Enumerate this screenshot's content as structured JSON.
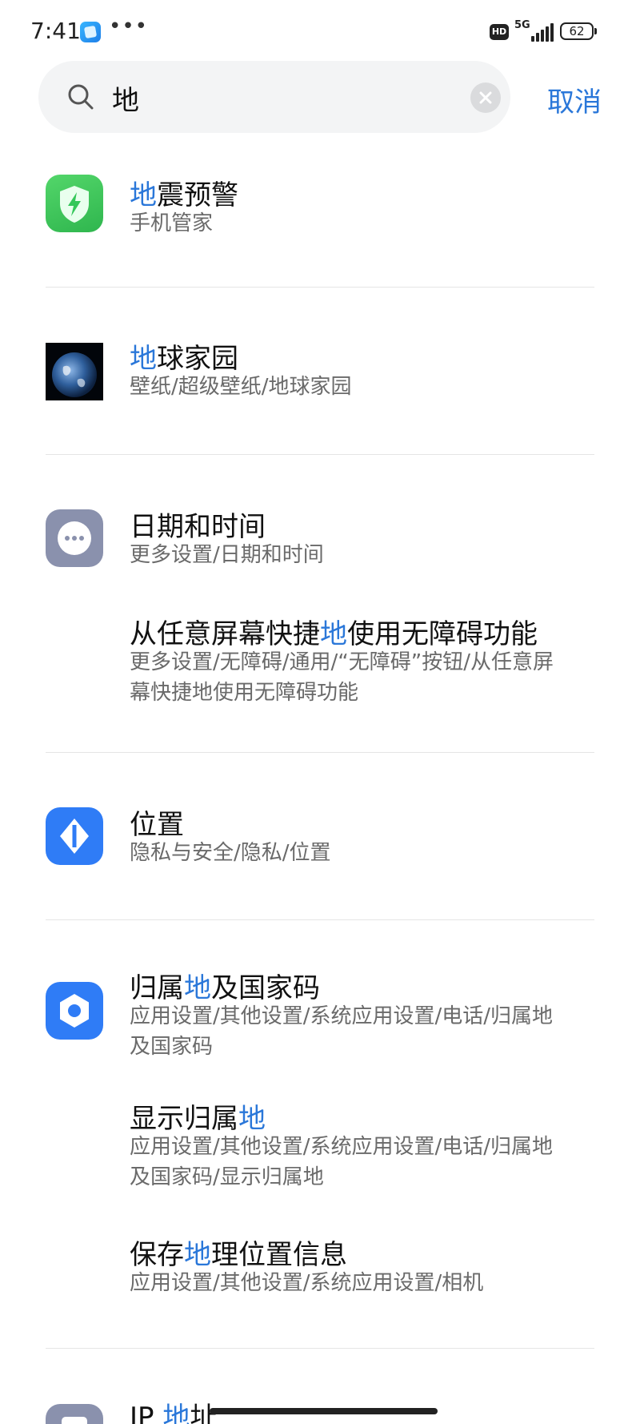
{
  "status_bar": {
    "time": "7:41",
    "dots": "•••",
    "hd_label": "HD",
    "network": "5G",
    "battery_level": "62",
    "icons": [
      "app-icon",
      "hd-icon",
      "signal-icon",
      "battery-icon"
    ]
  },
  "search": {
    "query": "地",
    "cancel_label": "取消",
    "icons": [
      "search-icon",
      "clear-icon"
    ]
  },
  "results": [
    {
      "icon": "shield-bolt-icon",
      "icon_color": "#34c759",
      "title_parts": [
        "地",
        "震预警"
      ],
      "subtitle": "手机管家"
    },
    {
      "icon": "earth-image-icon",
      "title_parts": [
        "地",
        "球家园"
      ],
      "subtitle": "壁纸/超级壁纸/地球家园"
    },
    {
      "icon": "more-settings-icon",
      "icon_color": "#8a91ad",
      "title_parts": [
        "日期和时间"
      ],
      "subtitle": "更多设置/日期和时间"
    },
    {
      "title_parts": [
        "从任意屏幕快捷",
        "地",
        "使用无障碍功能"
      ],
      "subtitle_lines": [
        "更多设置/无障碍/通用/“无障碍”按钮/从任意屏",
        "幕快捷地使用无障碍功能"
      ]
    },
    {
      "icon": "location-icon",
      "icon_color": "#2f7cf6",
      "title_parts": [
        "位置"
      ],
      "subtitle": "隐私与安全/隐私/位置"
    },
    {
      "icon": "app-settings-icon",
      "icon_color": "#2f7cf6",
      "title_parts": [
        "归属",
        "地",
        "及国家码"
      ],
      "subtitle_lines": [
        "应用设置/其他设置/系统应用设置/电话/归属地",
        "及国家码"
      ]
    },
    {
      "title_parts": [
        "显示归属",
        "地"
      ],
      "subtitle_lines": [
        "应用设置/其他设置/系统应用设置/电话/归属地",
        "及国家码/显示归属地"
      ]
    },
    {
      "title_parts": [
        "保存",
        "地",
        "理位置信息"
      ],
      "subtitle": "应用设置/其他设置/系统应用设置/相机"
    },
    {
      "icon": "ip-address-icon",
      "icon_color": "#8a91ad",
      "title_parts": [
        "IP ",
        "地",
        "址"
      ]
    }
  ],
  "colors": {
    "accent": "#2a77d9",
    "subtitle": "#6a6a6a",
    "divider": "#e5e5e5"
  }
}
